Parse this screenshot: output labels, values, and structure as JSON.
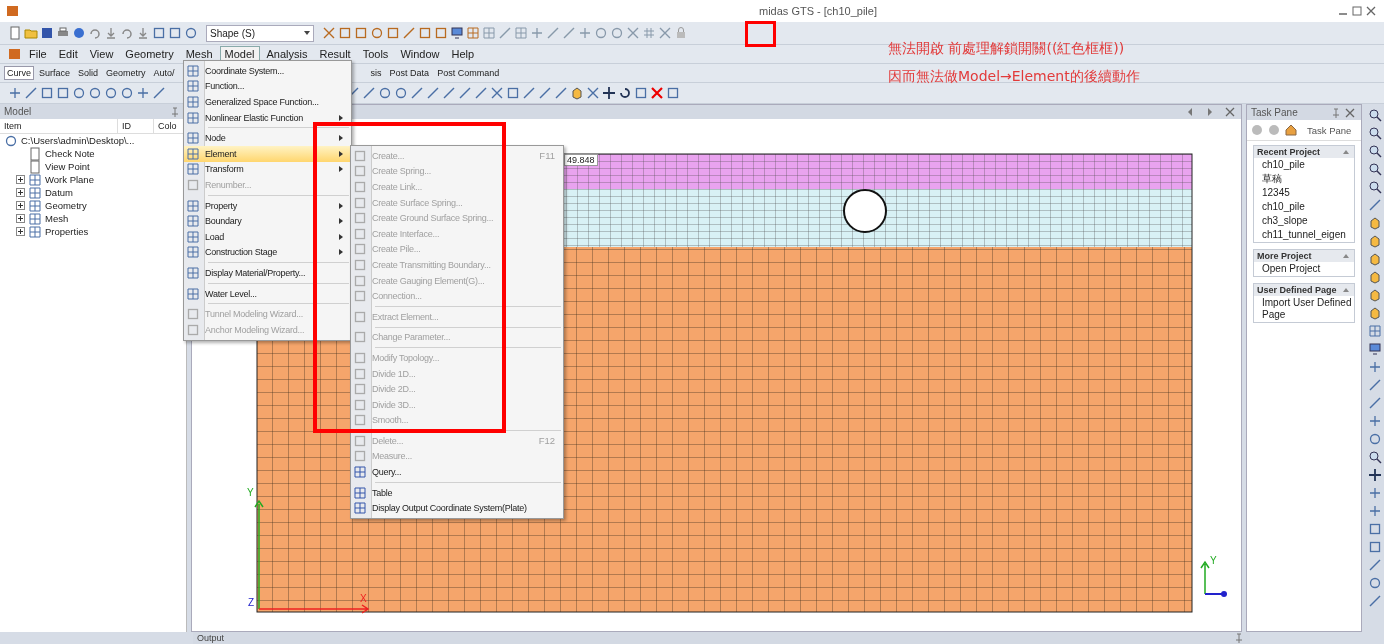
{
  "window": {
    "title": "midas GTS - [ch10_pile]"
  },
  "toolbar": {
    "shape_select": "Shape (S)"
  },
  "menu_bar": {
    "items": [
      {
        "label": "File",
        "selected": false
      },
      {
        "label": "Edit",
        "selected": false
      },
      {
        "label": "View",
        "selected": false
      },
      {
        "label": "Geometry",
        "selected": false
      },
      {
        "label": "Mesh",
        "selected": false
      },
      {
        "label": "Model",
        "selected": true
      },
      {
        "label": "Analysis",
        "selected": false
      },
      {
        "label": "Result",
        "selected": false
      },
      {
        "label": "Tools",
        "selected": false
      },
      {
        "label": "Window",
        "selected": false
      },
      {
        "label": "Help",
        "selected": false
      }
    ]
  },
  "ribbon_tabs": [
    {
      "label": "Curve",
      "selected": true
    },
    {
      "label": "Surface",
      "selected": false
    },
    {
      "label": "Solid",
      "selected": false
    },
    {
      "label": "Geometry",
      "selected": false
    },
    {
      "label": "Auto/",
      "selected": false
    },
    {
      "label": "sis",
      "selected": false
    },
    {
      "label": "Post Data",
      "selected": false
    },
    {
      "label": "Post Command",
      "selected": false
    }
  ],
  "model_panel": {
    "title": "Model",
    "columns": [
      "Item",
      "ID",
      "Colo"
    ],
    "tree": [
      {
        "kind": "root",
        "label": "C:\\Users\\admin\\Desktop\\...",
        "children": [
          {
            "kind": "leaf",
            "label": "Check Note"
          },
          {
            "kind": "leaf",
            "label": "View Point"
          },
          {
            "kind": "group",
            "label": "Work Plane"
          },
          {
            "kind": "group",
            "label": "Datum"
          },
          {
            "kind": "group",
            "label": "Geometry"
          },
          {
            "kind": "group",
            "label": "Mesh"
          },
          {
            "kind": "group",
            "label": "Properties"
          }
        ]
      }
    ]
  },
  "viewport": {
    "dimension_label": "49.848",
    "axis_labels": [
      "Y",
      "Z",
      "X"
    ],
    "triad_label": "Y"
  },
  "model_menu": {
    "items": [
      {
        "kind": "item",
        "label": "Coordinate System...",
        "submenu": false,
        "disabled": false,
        "selected": false
      },
      {
        "kind": "item",
        "label": "Function...",
        "submenu": false,
        "disabled": false,
        "selected": false
      },
      {
        "kind": "item",
        "label": "Generalized Space Function...",
        "submenu": false,
        "disabled": false,
        "selected": false
      },
      {
        "kind": "item",
        "label": "Nonlinear Elastic Function",
        "submenu": true,
        "disabled": false,
        "selected": false
      },
      {
        "kind": "separator"
      },
      {
        "kind": "item",
        "label": "Node",
        "submenu": true,
        "disabled": false,
        "selected": false
      },
      {
        "kind": "item",
        "label": "Element",
        "submenu": true,
        "disabled": false,
        "selected": true
      },
      {
        "kind": "item",
        "label": "Transform",
        "submenu": true,
        "disabled": false,
        "selected": false
      },
      {
        "kind": "item",
        "label": "Renumber...",
        "submenu": false,
        "disabled": true,
        "selected": false
      },
      {
        "kind": "separator"
      },
      {
        "kind": "item",
        "label": "Property",
        "submenu": true,
        "disabled": false,
        "selected": false
      },
      {
        "kind": "item",
        "label": "Boundary",
        "submenu": true,
        "disabled": false,
        "selected": false
      },
      {
        "kind": "item",
        "label": "Load",
        "submenu": true,
        "disabled": false,
        "selected": false
      },
      {
        "kind": "item",
        "label": "Construction Stage",
        "submenu": true,
        "disabled": false,
        "selected": false
      },
      {
        "kind": "separator"
      },
      {
        "kind": "item",
        "label": "Display Material/Property...",
        "submenu": false,
        "disabled": false,
        "selected": false
      },
      {
        "kind": "separator"
      },
      {
        "kind": "item",
        "label": "Water Level...",
        "submenu": false,
        "disabled": false,
        "selected": false
      },
      {
        "kind": "separator"
      },
      {
        "kind": "item",
        "label": "Tunnel Modeling Wizard...",
        "submenu": false,
        "disabled": true,
        "selected": false
      },
      {
        "kind": "item",
        "label": "Anchor Modeling Wizard...",
        "submenu": false,
        "disabled": true,
        "selected": false
      }
    ]
  },
  "element_menu": {
    "items": [
      {
        "kind": "item",
        "label": "Create...",
        "shortcut": "F11",
        "disabled": true
      },
      {
        "kind": "item",
        "label": "Create Spring...",
        "disabled": true
      },
      {
        "kind": "item",
        "label": "Create Link...",
        "disabled": true
      },
      {
        "kind": "item",
        "label": "Create Surface Spring...",
        "disabled": true
      },
      {
        "kind": "item",
        "label": "Create Ground Surface Spring...",
        "disabled": true
      },
      {
        "kind": "item",
        "label": "Create Interface...",
        "disabled": true
      },
      {
        "kind": "item",
        "label": "Create Pile...",
        "disabled": true
      },
      {
        "kind": "item",
        "label": "Create Transmitting Boundary...",
        "disabled": true
      },
      {
        "kind": "item",
        "label": "Create Gauging Element(G)...",
        "disabled": true
      },
      {
        "kind": "item",
        "label": "Connection...",
        "disabled": true
      },
      {
        "kind": "separator"
      },
      {
        "kind": "item",
        "label": "Extract Element...",
        "disabled": true
      },
      {
        "kind": "separator"
      },
      {
        "kind": "item",
        "label": "Change Parameter...",
        "disabled": true
      },
      {
        "kind": "separator"
      },
      {
        "kind": "item",
        "label": "Modify Topology...",
        "disabled": true
      },
      {
        "kind": "item",
        "label": "Divide 1D...",
        "disabled": true
      },
      {
        "kind": "item",
        "label": "Divide 2D...",
        "disabled": true
      },
      {
        "kind": "item",
        "label": "Divide 3D...",
        "disabled": true
      },
      {
        "kind": "item",
        "label": "Smooth...",
        "disabled": true
      },
      {
        "kind": "separator"
      },
      {
        "kind": "item",
        "label": "Delete...",
        "shortcut": "F12",
        "disabled": true
      },
      {
        "kind": "item",
        "label": "Measure...",
        "disabled": true
      },
      {
        "kind": "item",
        "label": "Query...",
        "disabled": false
      },
      {
        "kind": "separator"
      },
      {
        "kind": "item",
        "label": "Table",
        "disabled": false
      },
      {
        "kind": "item",
        "label": "Display Output Coordinate System(Plate)",
        "disabled": false
      }
    ]
  },
  "task_pane": {
    "title": "Task Pane",
    "nav_label": "Task Pane",
    "sections": [
      {
        "title": "Recent Project",
        "expanded": true,
        "items": [
          "ch10_pile",
          "草稿",
          "12345",
          "ch10_pile",
          "ch3_slope",
          "ch11_tunnel_eigen"
        ]
      },
      {
        "title": "More Project",
        "expanded": true,
        "items": [
          "Open Project"
        ]
      },
      {
        "title": "User Defined Page",
        "expanded": true,
        "items": [
          "Import User Defined Page"
        ]
      }
    ]
  },
  "output": {
    "title": "Output"
  },
  "annotation": {
    "lines": [
      "無法開啟 前處理解鎖開關((紅色框框))",
      "因而無法做Model→Element的後續動作"
    ]
  }
}
